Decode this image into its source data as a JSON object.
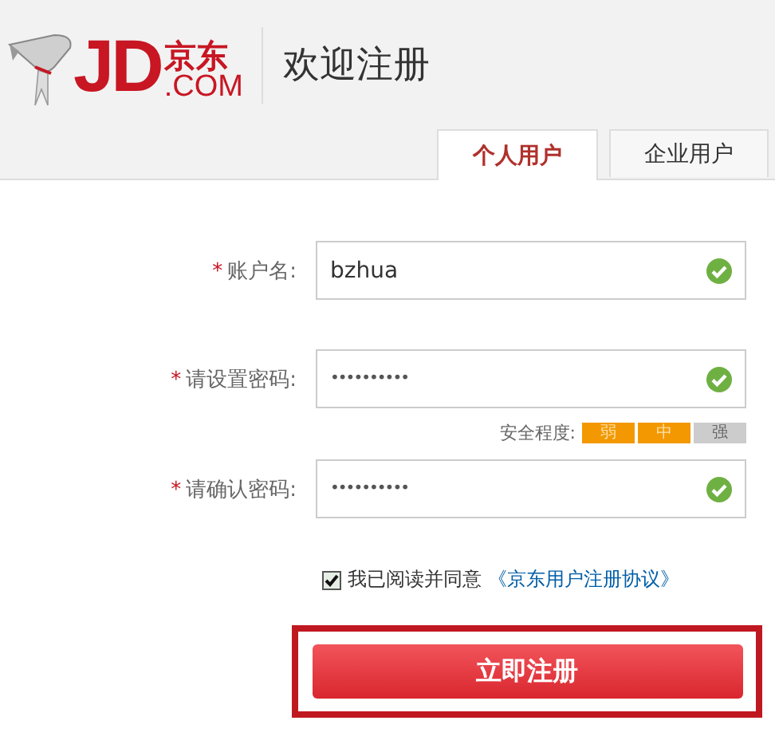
{
  "logo": {
    "mark": "JD",
    "cn": "京东",
    "domain": ".COM"
  },
  "header": {
    "title": "欢迎注册"
  },
  "tabs": [
    {
      "label": "个人用户",
      "selected": true
    },
    {
      "label": "企业用户",
      "selected": false
    }
  ],
  "fields": [
    {
      "required": "*",
      "label": "账户名:",
      "value": "bzhua",
      "valid": true
    },
    {
      "required": "*",
      "label": "请设置密码:",
      "value": "••••••••••",
      "valid": true,
      "strength": {
        "label": "安全程度:",
        "segments": [
          {
            "label": "弱",
            "on": true
          },
          {
            "label": "中",
            "on": true
          },
          {
            "label": "强",
            "on": false
          }
        ]
      }
    },
    {
      "required": "*",
      "label": "请确认密码:",
      "value": "••••••••••",
      "valid": true
    }
  ],
  "agreement": {
    "checked": true,
    "text": "我已阅读并同意",
    "link": "《京东用户注册协议》"
  },
  "submit": {
    "label": "立即注册",
    "highlighted": true
  }
}
